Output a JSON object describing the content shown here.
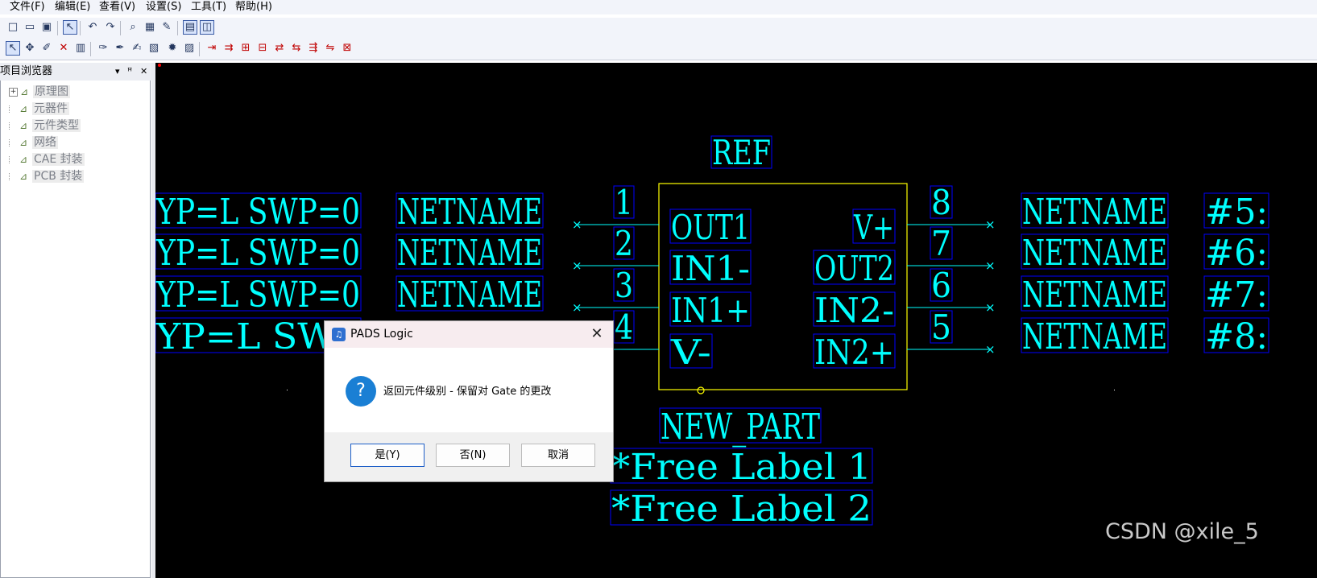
{
  "menubar": {
    "items": [
      "文件(F)",
      "编辑(E)",
      "查看(V)",
      "设置(S)",
      "工具(T)",
      "帮助(H)"
    ]
  },
  "toolbar1": {
    "buttons": [
      {
        "icon": "new-file-icon",
        "glyph": "□"
      },
      {
        "icon": "open-folder-icon",
        "glyph": "▭"
      },
      {
        "icon": "save-icon",
        "glyph": "▣"
      },
      {
        "icon": "select-mode-icon",
        "glyph": "↖",
        "pressed": true
      },
      {
        "icon": "undo-icon",
        "glyph": "↶"
      },
      {
        "icon": "redo-icon",
        "glyph": "↷"
      },
      {
        "icon": "zoom-icon",
        "glyph": "⌕"
      },
      {
        "icon": "component-icon",
        "glyph": "▦"
      },
      {
        "icon": "paint-icon",
        "glyph": "✎"
      },
      {
        "icon": "view-1-icon",
        "glyph": "▤",
        "pressed": true
      },
      {
        "icon": "view-2-icon",
        "glyph": "◫",
        "pressed": true
      }
    ]
  },
  "toolbar2": {
    "buttons": [
      {
        "icon": "pointer-icon",
        "glyph": "↖",
        "pressed": true
      },
      {
        "icon": "move-icon",
        "glyph": "✥"
      },
      {
        "icon": "edit-icon",
        "glyph": "✐"
      },
      {
        "icon": "delete-icon",
        "glyph": "✕",
        "color": "#c00000"
      },
      {
        "icon": "properties-icon",
        "glyph": "▥"
      },
      {
        "icon": "add-2d-line-icon",
        "glyph": "✑"
      },
      {
        "icon": "add-text-icon",
        "glyph": "✒"
      },
      {
        "icon": "add-pin-icon",
        "glyph": "✍"
      },
      {
        "icon": "add-terminal-icon",
        "glyph": "▧"
      },
      {
        "icon": "explode-icon",
        "glyph": "✹"
      },
      {
        "icon": "cost-icon",
        "glyph": "▨"
      },
      {
        "icon": "pin-add-icon",
        "glyph": "⇥",
        "color": "#c00000"
      },
      {
        "icon": "pin-array-icon",
        "glyph": "⇉",
        "color": "#c00000"
      },
      {
        "icon": "pin-number-icon",
        "glyph": "⊞",
        "color": "#c00000"
      },
      {
        "icon": "pin-name-icon",
        "glyph": "⊟",
        "color": "#c00000"
      },
      {
        "icon": "pin-swap-icon",
        "glyph": "⇄",
        "color": "#c00000"
      },
      {
        "icon": "pin-type-icon",
        "glyph": "⇆",
        "color": "#c00000"
      },
      {
        "icon": "pin-set-type-icon",
        "glyph": "⇶",
        "color": "#c00000"
      },
      {
        "icon": "pin-swap-set-icon",
        "glyph": "⇋",
        "color": "#c00000"
      },
      {
        "icon": "pin-grid-icon",
        "glyph": "⊠",
        "color": "#c00000"
      }
    ]
  },
  "panel": {
    "title": "项目浏览器",
    "dropdown_glyph": "▾",
    "pin_glyph": "ꟸ",
    "close_glyph": "✕",
    "tree": [
      {
        "label": "原理图",
        "expandable": true
      },
      {
        "label": "元器件",
        "expandable": false
      },
      {
        "label": "元件类型",
        "expandable": false
      },
      {
        "label": "网络",
        "expandable": false
      },
      {
        "label": "CAE 封装",
        "expandable": false
      },
      {
        "label": "PCB 封装",
        "expandable": false
      }
    ]
  },
  "schematic": {
    "colors": {
      "text": "#00ffff",
      "box": "#0000ff",
      "body": "#ffff00",
      "pin": "#00ffff"
    },
    "ref": "REF",
    "part_type": "NEW_PART",
    "free_labels": [
      "*Free Label 1",
      "*Free Label 2"
    ],
    "left_pins": [
      {
        "number": "1",
        "name": "OUT1",
        "netname": "NETNAME",
        "attr": "YP=L SWP=0"
      },
      {
        "number": "2",
        "name": "IN1-",
        "netname": "NETNAME",
        "attr": "YP=L SWP=0"
      },
      {
        "number": "3",
        "name": "IN1+",
        "netname": "NETNAME",
        "attr": "YP=L SWP=0"
      },
      {
        "number": "4",
        "name": "V-",
        "netname": "",
        "attr": "YP=L SWP"
      }
    ],
    "right_pins": [
      {
        "number": "8",
        "name": "V+",
        "netname": "NETNAME",
        "attr": "#5:"
      },
      {
        "number": "7",
        "name": "OUT2",
        "netname": "NETNAME",
        "attr": "#6:"
      },
      {
        "number": "6",
        "name": "IN2-",
        "netname": "NETNAME",
        "attr": "#7:"
      },
      {
        "number": "5",
        "name": "IN2+",
        "netname": "NETNAME",
        "attr": "#8:"
      }
    ]
  },
  "dialog": {
    "title": "PADS Logic",
    "app_icon_glyph": "♫",
    "close_glyph": "✕",
    "icon_glyph": "?",
    "message": "返回元件级别 - 保留对 Gate 的更改",
    "buttons": {
      "yes": "是(Y)",
      "no": "否(N)",
      "cancel": "取消"
    }
  },
  "watermark": "CSDN @xile_5"
}
